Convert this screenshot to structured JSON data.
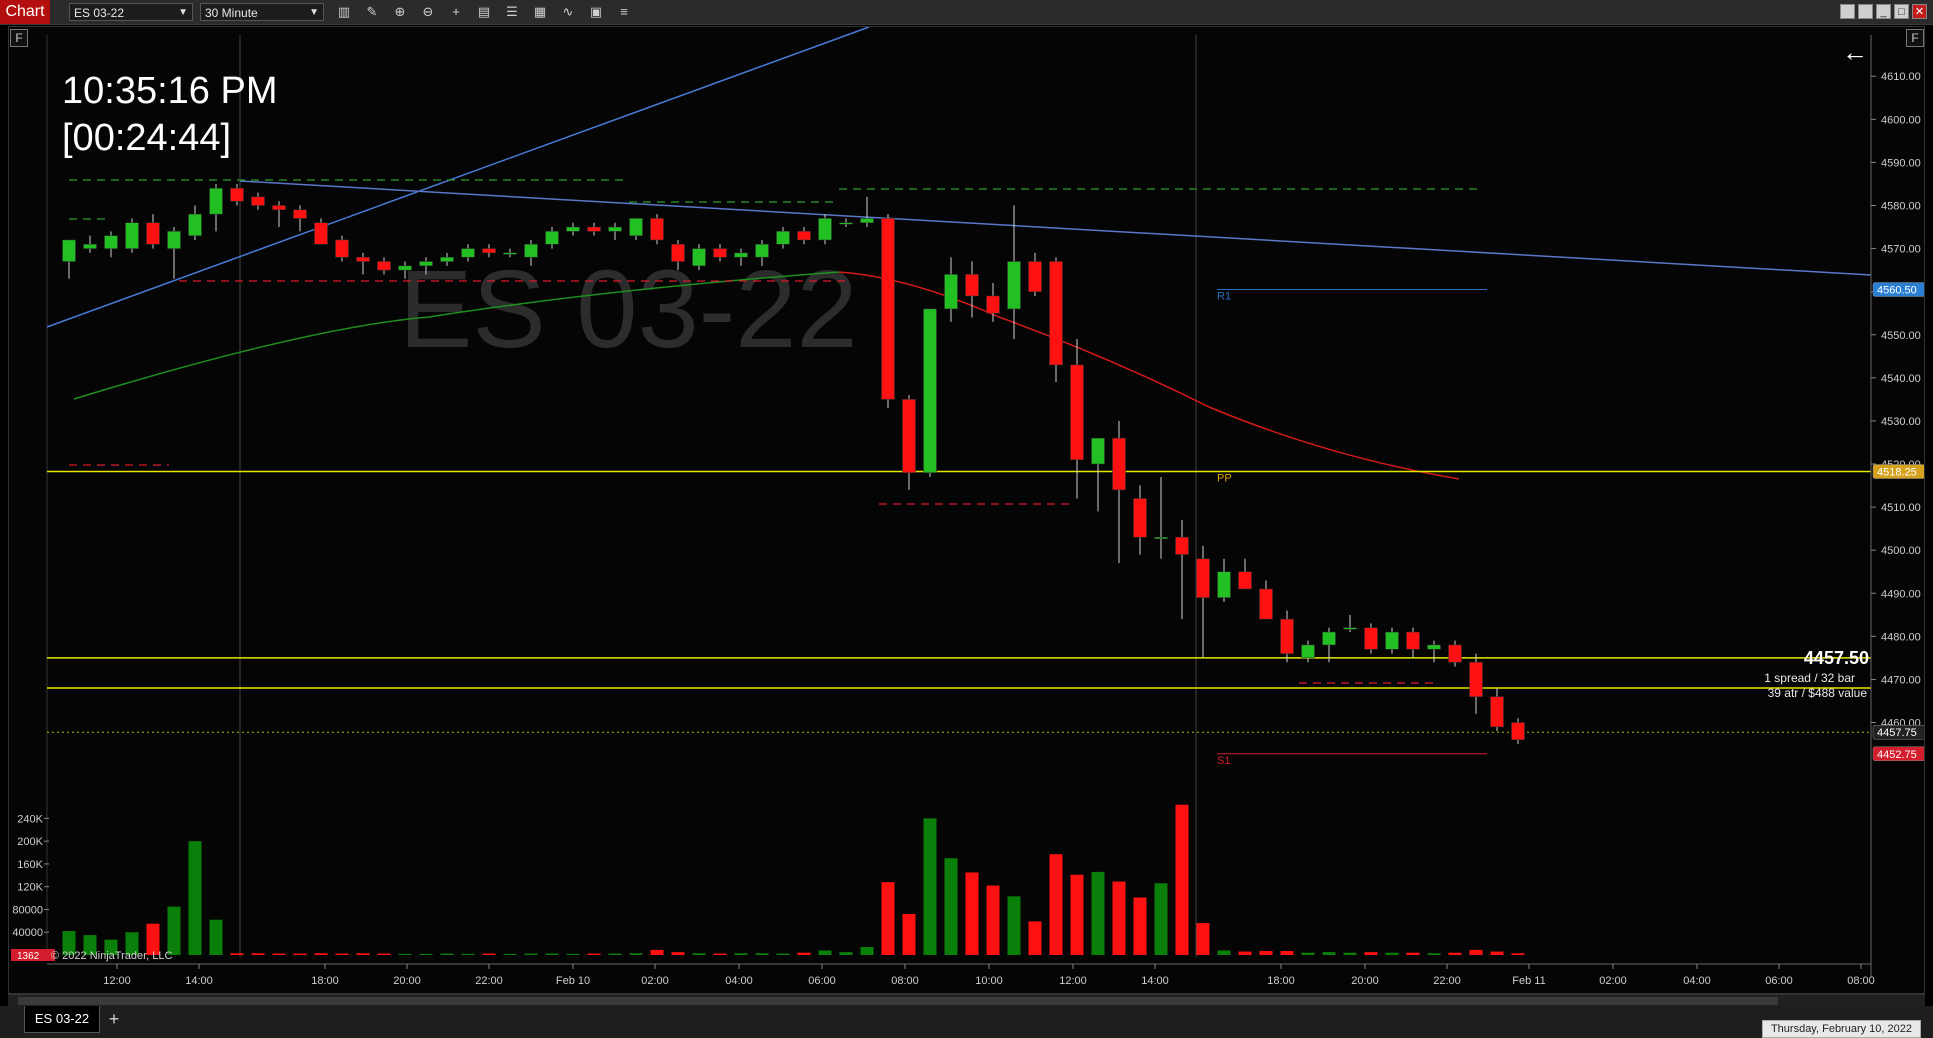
{
  "window": {
    "title": "Chart",
    "instrument": "ES 03-22",
    "timeframe": "30 Minute",
    "toolbar_icons": [
      "bar-type-icon",
      "draw-icon",
      "zoom-in-icon",
      "zoom-out-icon",
      "crosshair-icon",
      "template-icon",
      "properties-icon",
      "strategy-icon",
      "indicator-icon",
      "calculator-icon",
      "list-icon"
    ]
  },
  "overlay": {
    "clock": "10:35:16 PM",
    "bar_timer": "[00:24:44]",
    "watermark": "ES 03-22",
    "f_left": "F",
    "f_right": "F",
    "back_arrow": "←",
    "copyright": "© 2022 NinjaTrader, LLC",
    "volume_box": "1362"
  },
  "levels": {
    "r1": "R1",
    "pp": "PP",
    "s1": "S1",
    "price_label": "4457.50",
    "note1": "1 spread / 32 bar",
    "note2": "39 atr / $488 value"
  },
  "price_axis": {
    "ticks": [
      "4610.00",
      "4600.00",
      "4590.00",
      "4580.00",
      "4570.00",
      "4560.00",
      "4550.00",
      "4540.00",
      "4530.00",
      "4520.00",
      "4510.00",
      "4500.00",
      "4490.00",
      "4480.00",
      "4470.00",
      "4460.00"
    ],
    "tags": [
      {
        "text": "4560.50",
        "price": 4560.5,
        "color": "#2a7fd4"
      },
      {
        "text": "4518.25",
        "price": 4518.25,
        "color": "#d6a21e"
      },
      {
        "text": "4457.75",
        "price": 4457.75,
        "color": "#222222"
      },
      {
        "text": "4452.75",
        "price": 4452.75,
        "color": "#d31c2c"
      }
    ]
  },
  "volume_axis": {
    "ticks": [
      "240K",
      "200K",
      "160K",
      "120K",
      "80000",
      "40000"
    ]
  },
  "time_axis": {
    "ticks": [
      "12:00",
      "14:00",
      "18:00",
      "20:00",
      "22:00",
      "Feb 10",
      "02:00",
      "04:00",
      "06:00",
      "08:00",
      "10:00",
      "12:00",
      "14:00",
      "18:00",
      "20:00",
      "22:00",
      "Feb 11",
      "02:00",
      "04:00",
      "06:00",
      "08:00"
    ]
  },
  "chart_data": {
    "type": "candlestick",
    "instrument": "ES 03-22",
    "interval": "30 Minute",
    "ylim": [
      4452,
      4614
    ],
    "volume_ylim": [
      0,
      260000
    ],
    "candles": [
      {
        "o": 4567,
        "h": 4572,
        "l": 4563,
        "c": 4572,
        "v": 42000
      },
      {
        "o": 4570,
        "h": 4573,
        "l": 4569,
        "c": 4571,
        "v": 35000
      },
      {
        "o": 4570,
        "h": 4574,
        "l": 4568,
        "c": 4573,
        "v": 27000
      },
      {
        "o": 4570,
        "h": 4577,
        "l": 4569,
        "c": 4576,
        "v": 40000
      },
      {
        "o": 4576,
        "h": 4578,
        "l": 4570,
        "c": 4571,
        "v": 55000
      },
      {
        "o": 4570,
        "h": 4575,
        "l": 4563,
        "c": 4574,
        "v": 85000
      },
      {
        "o": 4573,
        "h": 4580,
        "l": 4572,
        "c": 4578,
        "v": 200000
      },
      {
        "o": 4578,
        "h": 4585,
        "l": 4574,
        "c": 4584,
        "v": 62000
      },
      {
        "o": 4584,
        "h": 4585,
        "l": 4580,
        "c": 4581,
        "v": 3000
      },
      {
        "o": 4582,
        "h": 4583,
        "l": 4579,
        "c": 4580,
        "v": 3000
      },
      {
        "o": 4580,
        "h": 4581,
        "l": 4575,
        "c": 4579,
        "v": 2500
      },
      {
        "o": 4579,
        "h": 4580,
        "l": 4574,
        "c": 4577,
        "v": 2500
      },
      {
        "o": 4576,
        "h": 4577,
        "l": 4571,
        "c": 4571,
        "v": 3000
      },
      {
        "o": 4572,
        "h": 4573,
        "l": 4567,
        "c": 4568,
        "v": 2500
      },
      {
        "o": 4568,
        "h": 4569,
        "l": 4564,
        "c": 4567,
        "v": 3000
      },
      {
        "o": 4567,
        "h": 4568,
        "l": 4564,
        "c": 4565,
        "v": 2500
      },
      {
        "o": 4565,
        "h": 4567,
        "l": 4563,
        "c": 4566,
        "v": 2000
      },
      {
        "o": 4566,
        "h": 4568,
        "l": 4564,
        "c": 4567,
        "v": 2000
      },
      {
        "o": 4567,
        "h": 4569,
        "l": 4566,
        "c": 4568,
        "v": 2500
      },
      {
        "o": 4568,
        "h": 4571,
        "l": 4567,
        "c": 4570,
        "v": 2000
      },
      {
        "o": 4570,
        "h": 4571,
        "l": 4568,
        "c": 4569,
        "v": 2500
      },
      {
        "o": 4569,
        "h": 4570,
        "l": 4568,
        "c": 4569,
        "v": 2000
      },
      {
        "o": 4568,
        "h": 4572,
        "l": 4566,
        "c": 4571,
        "v": 2500
      },
      {
        "o": 4571,
        "h": 4575,
        "l": 4570,
        "c": 4574,
        "v": 2500
      },
      {
        "o": 4574,
        "h": 4576,
        "l": 4573,
        "c": 4575,
        "v": 2000
      },
      {
        "o": 4575,
        "h": 4576,
        "l": 4573,
        "c": 4574,
        "v": 2500
      },
      {
        "o": 4574,
        "h": 4576,
        "l": 4572,
        "c": 4575,
        "v": 2500
      },
      {
        "o": 4573,
        "h": 4577,
        "l": 4572,
        "c": 4577,
        "v": 3000
      },
      {
        "o": 4577,
        "h": 4578,
        "l": 4571,
        "c": 4572,
        "v": 9000
      },
      {
        "o": 4571,
        "h": 4572,
        "l": 4565,
        "c": 4567,
        "v": 5000
      },
      {
        "o": 4566,
        "h": 4571,
        "l": 4565,
        "c": 4570,
        "v": 3000
      },
      {
        "o": 4570,
        "h": 4571,
        "l": 4567,
        "c": 4568,
        "v": 2500
      },
      {
        "o": 4568,
        "h": 4570,
        "l": 4566,
        "c": 4569,
        "v": 3000
      },
      {
        "o": 4568,
        "h": 4572,
        "l": 4566,
        "c": 4571,
        "v": 3000
      },
      {
        "o": 4571,
        "h": 4575,
        "l": 4570,
        "c": 4574,
        "v": 2500
      },
      {
        "o": 4574,
        "h": 4575,
        "l": 4571,
        "c": 4572,
        "v": 4000
      },
      {
        "o": 4572,
        "h": 4578,
        "l": 4571,
        "c": 4577,
        "v": 8000
      },
      {
        "o": 4576,
        "h": 4577,
        "l": 4575,
        "c": 4576,
        "v": 5000
      },
      {
        "o": 4576,
        "h": 4582,
        "l": 4575,
        "c": 4577,
        "v": 14000
      },
      {
        "o": 4577,
        "h": 4578,
        "l": 4533,
        "c": 4535,
        "v": 128000
      },
      {
        "o": 4535,
        "h": 4536,
        "l": 4514,
        "c": 4518,
        "v": 72000
      },
      {
        "o": 4518,
        "h": 4556,
        "l": 4517,
        "c": 4556,
        "v": 240000
      },
      {
        "o": 4556,
        "h": 4568,
        "l": 4553,
        "c": 4564,
        "v": 170000
      },
      {
        "o": 4564,
        "h": 4567,
        "l": 4554,
        "c": 4559,
        "v": 145000
      },
      {
        "o": 4559,
        "h": 4562,
        "l": 4553,
        "c": 4555,
        "v": 122000
      },
      {
        "o": 4556,
        "h": 4580,
        "l": 4549,
        "c": 4567,
        "v": 103000
      },
      {
        "o": 4567,
        "h": 4569,
        "l": 4559,
        "c": 4560,
        "v": 59000
      },
      {
        "o": 4567,
        "h": 4568,
        "l": 4539,
        "c": 4543,
        "v": 177000
      },
      {
        "o": 4543,
        "h": 4549,
        "l": 4512,
        "c": 4521,
        "v": 141000
      },
      {
        "o": 4520,
        "h": 4525,
        "l": 4509,
        "c": 4526,
        "v": 146000
      },
      {
        "o": 4526,
        "h": 4530,
        "l": 4497,
        "c": 4514,
        "v": 129000
      },
      {
        "o": 4512,
        "h": 4515,
        "l": 4499,
        "c": 4503,
        "v": 101000
      },
      {
        "o": 4503,
        "h": 4517,
        "l": 4498,
        "c": 4503,
        "v": 126000
      },
      {
        "o": 4503,
        "h": 4507,
        "l": 4484,
        "c": 4499,
        "v": 264000
      },
      {
        "o": 4498,
        "h": 4501,
        "l": 4475,
        "c": 4489,
        "v": 56000
      },
      {
        "o": 4489,
        "h": 4498,
        "l": 4488,
        "c": 4495,
        "v": 8000
      },
      {
        "o": 4495,
        "h": 4498,
        "l": 4491,
        "c": 4491,
        "v": 6000
      },
      {
        "o": 4491,
        "h": 4493,
        "l": 4485,
        "c": 4484,
        "v": 7000
      },
      {
        "o": 4484,
        "h": 4486,
        "l": 4474,
        "c": 4476,
        "v": 7000
      },
      {
        "o": 4475,
        "h": 4479,
        "l": 4474,
        "c": 4478,
        "v": 4000
      },
      {
        "o": 4478,
        "h": 4482,
        "l": 4474,
        "c": 4481,
        "v": 5000
      },
      {
        "o": 4482,
        "h": 4485,
        "l": 4481,
        "c": 4482,
        "v": 4000
      },
      {
        "o": 4482,
        "h": 4483,
        "l": 4476,
        "c": 4477,
        "v": 5000
      },
      {
        "o": 4477,
        "h": 4482,
        "l": 4476,
        "c": 4481,
        "v": 4000
      },
      {
        "o": 4481,
        "h": 4482,
        "l": 4475,
        "c": 4477,
        "v": 4000
      },
      {
        "o": 4477,
        "h": 4479,
        "l": 4474,
        "c": 4478,
        "v": 3000
      },
      {
        "o": 4478,
        "h": 4479,
        "l": 4473,
        "c": 4474,
        "v": 4000
      },
      {
        "o": 4474,
        "h": 4476,
        "l": 4462,
        "c": 4466,
        "v": 9000
      },
      {
        "o": 4466,
        "h": 4468,
        "l": 4458,
        "c": 4459,
        "v": 6000
      },
      {
        "o": 4460,
        "h": 4461,
        "l": 4455,
        "c": 4456,
        "v": 3000
      }
    ],
    "horizontal_lines": [
      {
        "price": 4518.25,
        "color": "#e6e600"
      },
      {
        "price": 4475,
        "color": "#e6e600"
      },
      {
        "price": 4468,
        "color": "#e6e600"
      },
      {
        "price": 4457.75,
        "color": "#b8b800",
        "style": "dotted"
      }
    ],
    "pivot_lines": [
      {
        "name": "R1",
        "price": 4560.5,
        "color": "#2a6fc0"
      },
      {
        "name": "PP",
        "price": 4518.25,
        "color": "#e6a800"
      },
      {
        "name": "S1",
        "price": 4452.75,
        "color": "#d31c2c"
      }
    ],
    "colors": {
      "up": "#22c022",
      "down": "#ff1111",
      "up_volume": "#0a7f0a",
      "down_volume": "#ff1111"
    }
  }
}
